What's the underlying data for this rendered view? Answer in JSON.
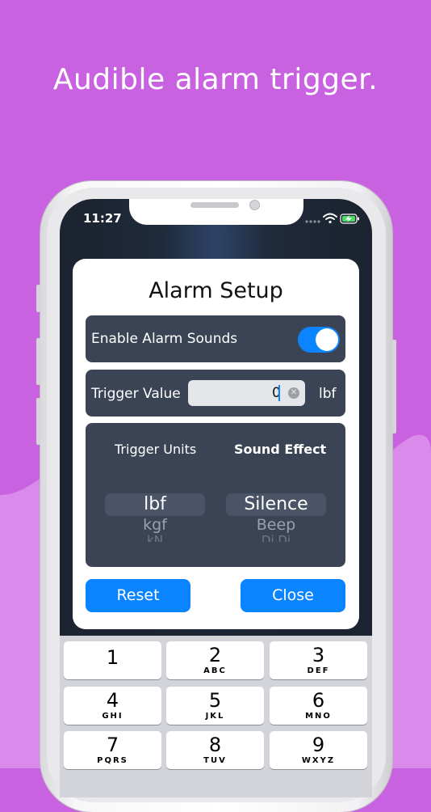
{
  "headline": "Audible alarm trigger.",
  "status_bar": {
    "time": "11:27"
  },
  "dialog": {
    "title": "Alarm Setup",
    "enable_sounds": {
      "label": "Enable Alarm Sounds",
      "on": true
    },
    "trigger": {
      "label": "Trigger Value",
      "value": "0",
      "unit": "lbf"
    },
    "picker": {
      "units_header": "Trigger Units",
      "effect_header": "Sound Effect",
      "units_options": [
        "lbf",
        "kgf",
        "kN"
      ],
      "effect_options": [
        "Silence",
        "Beep",
        "Di Di"
      ]
    },
    "reset_label": "Reset",
    "close_label": "Close"
  },
  "keypad": {
    "keys": [
      {
        "digit": "1",
        "letters": ""
      },
      {
        "digit": "2",
        "letters": "ABC"
      },
      {
        "digit": "3",
        "letters": "DEF"
      },
      {
        "digit": "4",
        "letters": "GHI"
      },
      {
        "digit": "5",
        "letters": "JKL"
      },
      {
        "digit": "6",
        "letters": "MNO"
      },
      {
        "digit": "7",
        "letters": "PQRS"
      },
      {
        "digit": "8",
        "letters": "TUV"
      },
      {
        "digit": "9",
        "letters": "WXYZ"
      }
    ]
  },
  "colors": {
    "background": "#c962e0",
    "accent": "#0a84ff",
    "panel": "#3b4455"
  }
}
